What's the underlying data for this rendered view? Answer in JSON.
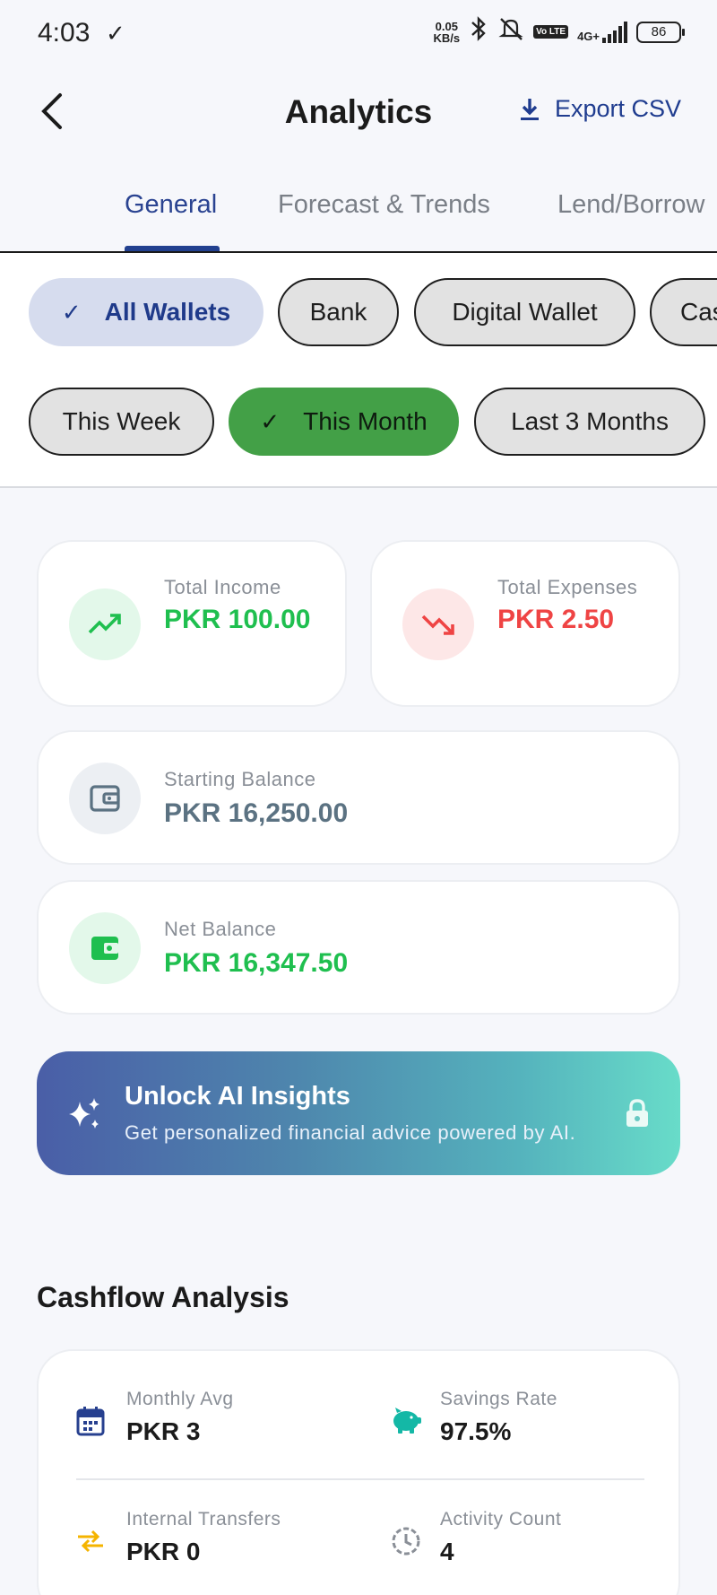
{
  "status_bar": {
    "time": "4:03",
    "net_speed_value": "0.05",
    "net_speed_unit": "KB/s",
    "volte": "Vo LTE",
    "network_type": "4G+",
    "battery": "86"
  },
  "app_bar": {
    "title": "Analytics",
    "export_label": "Export CSV"
  },
  "tabs": [
    {
      "label": "General",
      "active": true
    },
    {
      "label": "Forecast & Trends",
      "active": false
    },
    {
      "label": "Lend/Borrow",
      "active": false
    }
  ],
  "wallet_filters": [
    {
      "label": "All Wallets",
      "selected": true
    },
    {
      "label": "Bank",
      "selected": false
    },
    {
      "label": "Digital Wallet",
      "selected": false
    },
    {
      "label": "Cash",
      "selected": false
    }
  ],
  "period_filters": [
    {
      "label": "This Week",
      "selected": false
    },
    {
      "label": "This Month",
      "selected": true
    },
    {
      "label": "Last 3 Months",
      "selected": false
    }
  ],
  "summary": {
    "total_income": {
      "label": "Total Income",
      "value": "PKR 100.00",
      "icon": "trending-up-icon",
      "color": "#1fbf4f"
    },
    "total_expenses": {
      "label": "Total Expenses",
      "value": "PKR 2.50",
      "icon": "trending-down-icon",
      "color": "#ef4444"
    },
    "starting_balance": {
      "label": "Starting Balance",
      "value": "PKR 16,250.00",
      "icon": "wallet-outline-icon",
      "color": "#5b7282"
    },
    "net_balance": {
      "label": "Net Balance",
      "value": "PKR 16,347.50",
      "icon": "wallet-filled-icon",
      "color": "#1fbf4f"
    }
  },
  "ai_banner": {
    "title": "Unlock AI Insights",
    "subtitle": "Get personalized financial advice powered by AI.",
    "icon": "sparkles-icon",
    "lock_icon": "lock-icon"
  },
  "cashflow": {
    "title": "Cashflow Analysis",
    "items": [
      {
        "label": "Monthly Avg",
        "value": "PKR 3",
        "icon": "calendar-icon",
        "color": "#27408f"
      },
      {
        "label": "Savings Rate",
        "value": "97.5%",
        "icon": "piggy-bank-icon",
        "color": "#14b8a6"
      },
      {
        "label": "Internal Transfers",
        "value": "PKR 0",
        "icon": "transfer-arrows-icon",
        "color": "#f5b400"
      },
      {
        "label": "Activity Count",
        "value": "4",
        "icon": "history-icon",
        "color": "#8a8f97"
      }
    ]
  },
  "colors": {
    "primary": "#22408f",
    "income_green": "#1fbf4f",
    "expense_red": "#ef4444",
    "chip_selected_green": "#43a047",
    "chip_selected_blue": "#d6dcee"
  }
}
